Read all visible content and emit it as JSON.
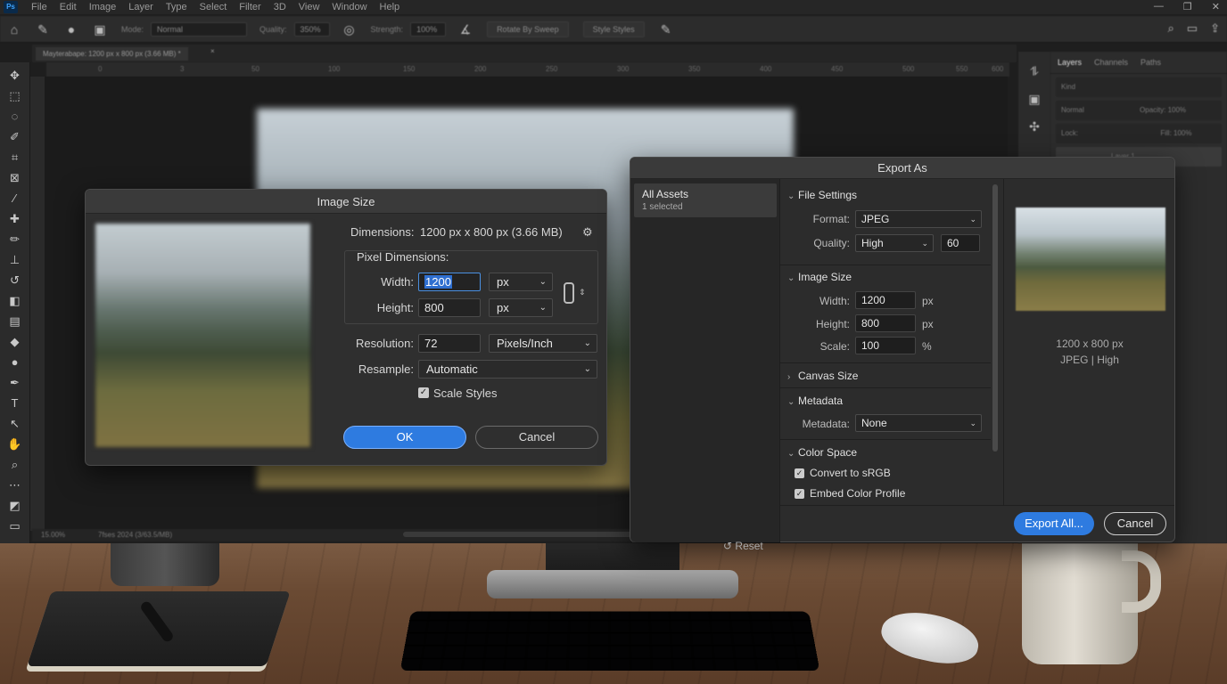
{
  "photoshop": {
    "logo": "Ps",
    "menu": [
      "File",
      "Edit",
      "Image",
      "Layer",
      "Type",
      "Select",
      "Filter",
      "3D",
      "View",
      "Window",
      "Help"
    ],
    "options_bar": {
      "mode_label": "Mode:",
      "mode_value": "Normal",
      "quality_label": "Quality:",
      "quality_value": "350%",
      "strength_label": "Strength:",
      "strength_value": "100%",
      "btn1": "Rotate By Sweep",
      "btn2": "Style Styles"
    },
    "document_tab": "Mayterabape: 1200 px x 800 px (3.66 MB) *",
    "ruler_ticks": [
      "0",
      "3",
      "50",
      "100",
      "150",
      "200",
      "250",
      "300",
      "350",
      "400",
      "450",
      "500",
      "550",
      "600"
    ],
    "status_left": "15.00%",
    "status_mid": "7fses 2024 (3/63.5/MB)",
    "panels": {
      "tabs": [
        "Layers",
        "Channels",
        "Paths"
      ],
      "kind": "Kind",
      "blend": "Normal",
      "opacity": "Opacity: 100%",
      "lock": "Lock:",
      "fill": "Fill: 100%",
      "layer_name": "Layer 1"
    }
  },
  "image_size": {
    "title": "Image Size",
    "dimensions_label": "Dimensions:",
    "dimensions_value": "1200 px x 800 px (3.66 MB)",
    "pixel_dimensions_label": "Pixel Dimensions:",
    "width_label": "Width:",
    "width_value": "1200",
    "width_unit": "px",
    "height_label": "Height:",
    "height_value": "800",
    "height_unit": "px",
    "resolution_label": "Resolution:",
    "resolution_value": "72",
    "resolution_unit": "Pixels/Inch",
    "resample_label": "Resample:",
    "resample_value": "Automatic",
    "scale_styles_label": "Scale Styles",
    "scale_styles_checked": true,
    "ok_label": "OK",
    "cancel_label": "Cancel"
  },
  "export_as": {
    "title": "Export As",
    "assets_title": "All Assets",
    "assets_sub": "1 selected",
    "reset_label": "Reset",
    "file_settings": {
      "heading": "File Settings",
      "format_label": "Format:",
      "format_value": "JPEG",
      "quality_label": "Quality:",
      "quality_value": "High",
      "quality_number": "60"
    },
    "image_size": {
      "heading": "Image Size",
      "width_label": "Width:",
      "width_value": "1200",
      "height_label": "Height:",
      "height_value": "800",
      "scale_label": "Scale:",
      "scale_value": "100",
      "px_unit": "px",
      "percent_unit": "%"
    },
    "canvas_size_heading": "Canvas Size",
    "metadata": {
      "heading": "Metadata",
      "label": "Metadata:",
      "value": "None"
    },
    "color_space": {
      "heading": "Color Space",
      "convert_label": "Convert to sRGB",
      "embed_label": "Embed Color Profile"
    },
    "preview_dims": "1200 x 800 px",
    "preview_format": "JPEG | High",
    "export_all_label": "Export All...",
    "cancel_label": "Cancel"
  }
}
